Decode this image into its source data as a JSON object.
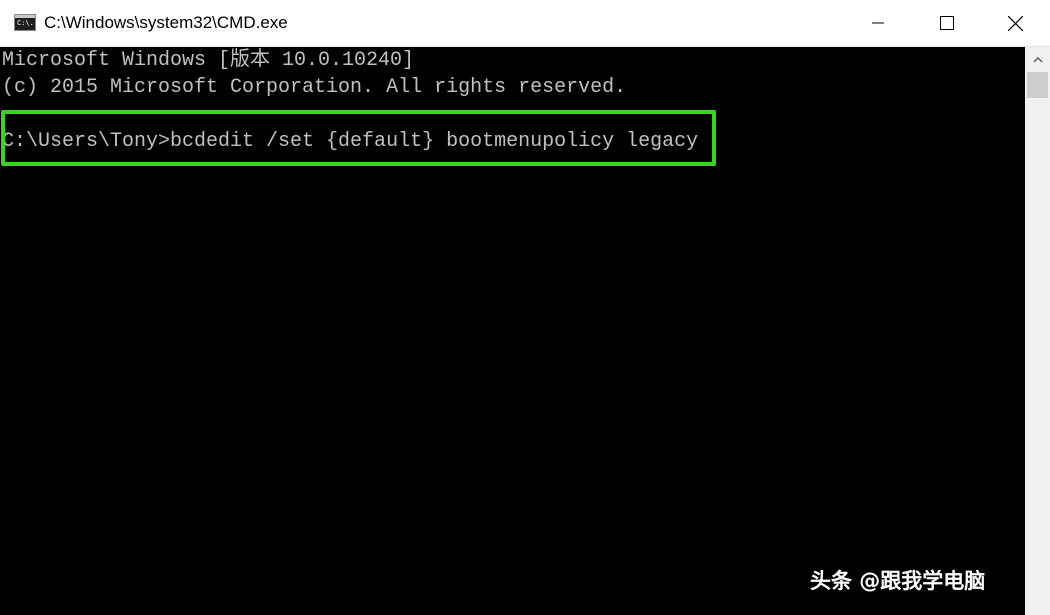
{
  "window": {
    "title": "C:\\Windows\\system32\\CMD.exe",
    "icon_text": "C:\\."
  },
  "terminal": {
    "lines": [
      "Microsoft Windows [版本 10.0.10240]",
      "(c) 2015 Microsoft Corporation. All rights reserved.",
      "",
      "C:\\Users\\Tony>bcdedit /set {default} bootmenupolicy legacy"
    ]
  },
  "highlight": {
    "color": "#3ad323"
  },
  "colors": {
    "terminal_bg": "#000000",
    "terminal_text": "#c0c0c0",
    "titlebar_bg": "#ffffff"
  },
  "icons": {
    "minimize": "minimize-icon",
    "maximize": "maximize-icon",
    "close": "close-icon",
    "scroll_up": "chevron-up-icon"
  },
  "watermark": {
    "text": "头条 @跟我学电脑"
  }
}
